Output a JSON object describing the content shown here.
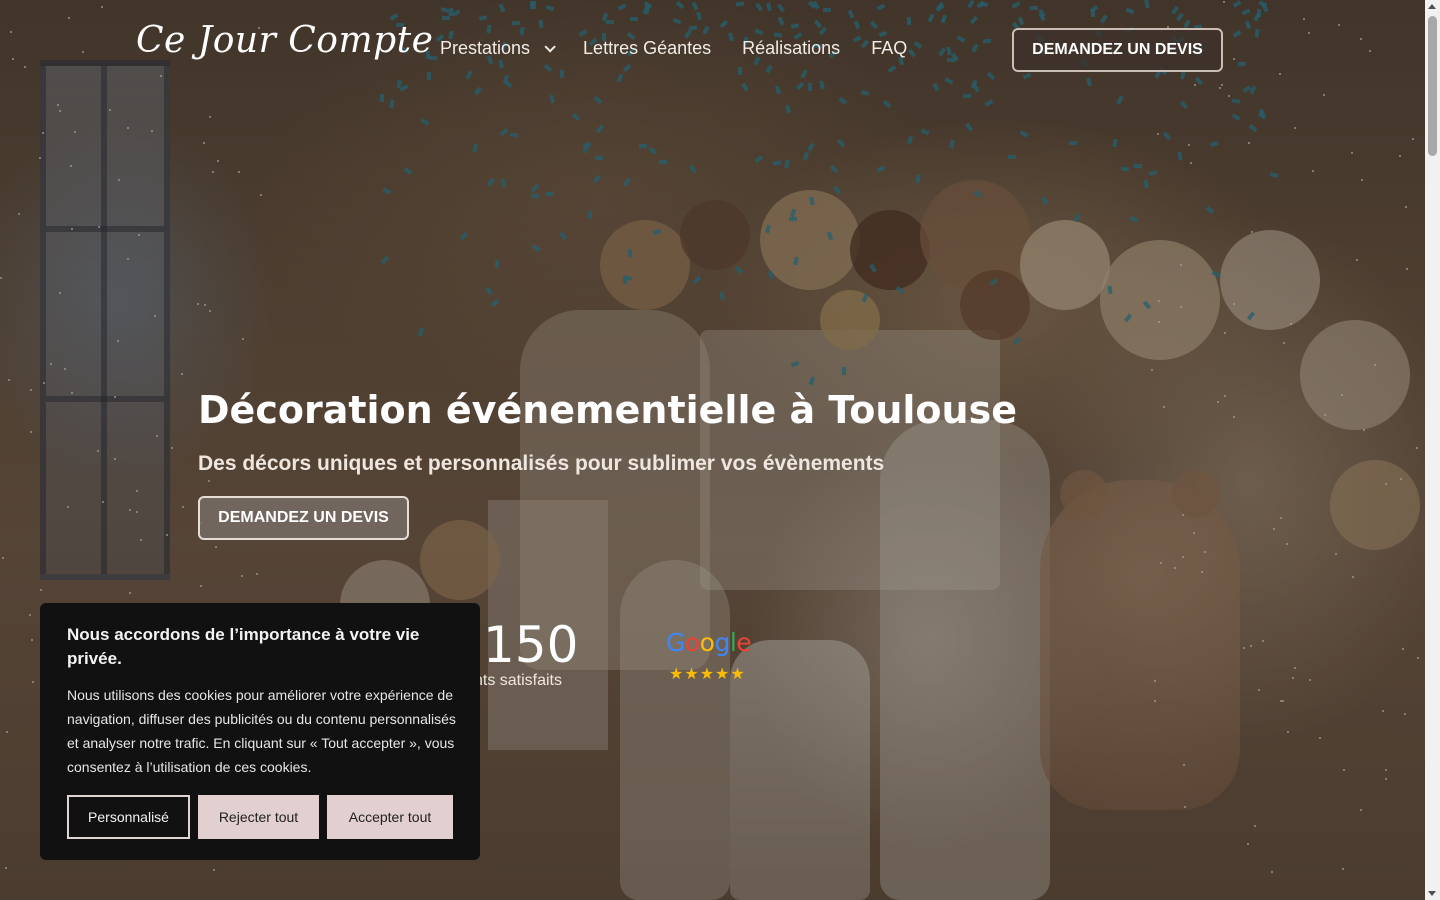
{
  "header": {
    "logo": "Ce Jour Compte",
    "nav": [
      "Prestations",
      "Lettres Géantes",
      "Réalisations",
      "FAQ"
    ],
    "cta": "DEMANDEZ UN DEVIS"
  },
  "hero": {
    "title": "Décoration événementielle à Toulouse",
    "subtitle": "Des décors uniques et personnalisés pour sublimer vos évènements",
    "cta": "DEMANDEZ UN DEVIS"
  },
  "stats": {
    "number": "150",
    "label": "Clients satisfaits",
    "google_letters": [
      "G",
      "o",
      "o",
      "g",
      "l",
      "e"
    ],
    "stars": "★★★★★",
    "rating": 5
  },
  "cookie": {
    "title": "Nous accordons de l’importance à votre vie privée.",
    "text": "Nous utilisons des cookies pour améliorer votre expérience de navigation, diffuser des publicités ou du contenu personnalisés et analyser notre trafic. En cliquant sur « Tout accepter », vous consentez à l’utilisation de ces cookies.",
    "buttons": {
      "customize": "Personnalisé",
      "reject": "Rejecter tout",
      "accept": "Accepter tout"
    }
  },
  "colors": {
    "accent_button": "#e2cfcf",
    "banner_bg": "#111111",
    "google_blue": "#4285f4",
    "google_red": "#ea4335",
    "google_yellow": "#fbbc05",
    "google_green": "#34a853"
  }
}
